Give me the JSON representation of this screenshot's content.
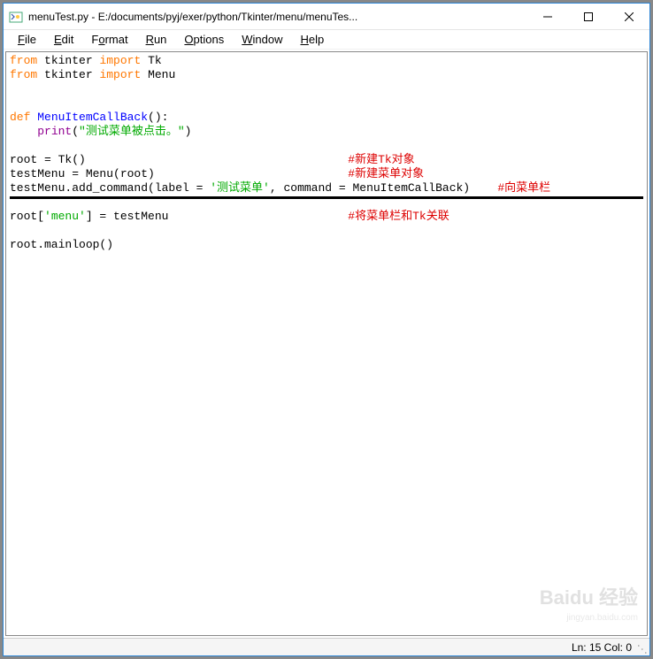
{
  "window": {
    "title": "menuTest.py - E:/documents/pyj/exer/python/Tkinter/menu/menuTes..."
  },
  "menubar": {
    "file": "File",
    "edit": "Edit",
    "format": "Format",
    "run": "Run",
    "options": "Options",
    "window": "Window",
    "help": "Help"
  },
  "code": {
    "l1": {
      "from": "from",
      "mod": "tkinter",
      "import": "import",
      "name": "Tk"
    },
    "l2": {
      "from": "from",
      "mod": "tkinter",
      "import": "import",
      "name": "Menu"
    },
    "l4": {
      "def": "def",
      "fname": "MenuItemCallBack",
      "after": "():"
    },
    "l5": {
      "fn": "print",
      "open": "(",
      "str": "\"测试菜单被点击。\"",
      "close": ")"
    },
    "l7": {
      "text": "root = Tk()",
      "comment": "#新建Tk对象"
    },
    "l8": {
      "text": "testMenu = Menu(root)",
      "comment": "#新建菜单对象"
    },
    "l9": {
      "pre": "testMenu.add_command(label = ",
      "str": "'测试菜单'",
      "mid": ", command = MenuItemCallBack)",
      "comment": "#向菜单栏"
    },
    "l11": {
      "pre": "root[",
      "key": "'menu'",
      "post": "] = testMenu",
      "comment": "#将菜单栏和Tk关联"
    },
    "l13": {
      "text": "root.mainloop()"
    }
  },
  "status": {
    "text": "Ln: 15   Col: 0"
  },
  "watermark": {
    "main": "Baidu 经验",
    "sub": "jingyan.baidu.com"
  }
}
